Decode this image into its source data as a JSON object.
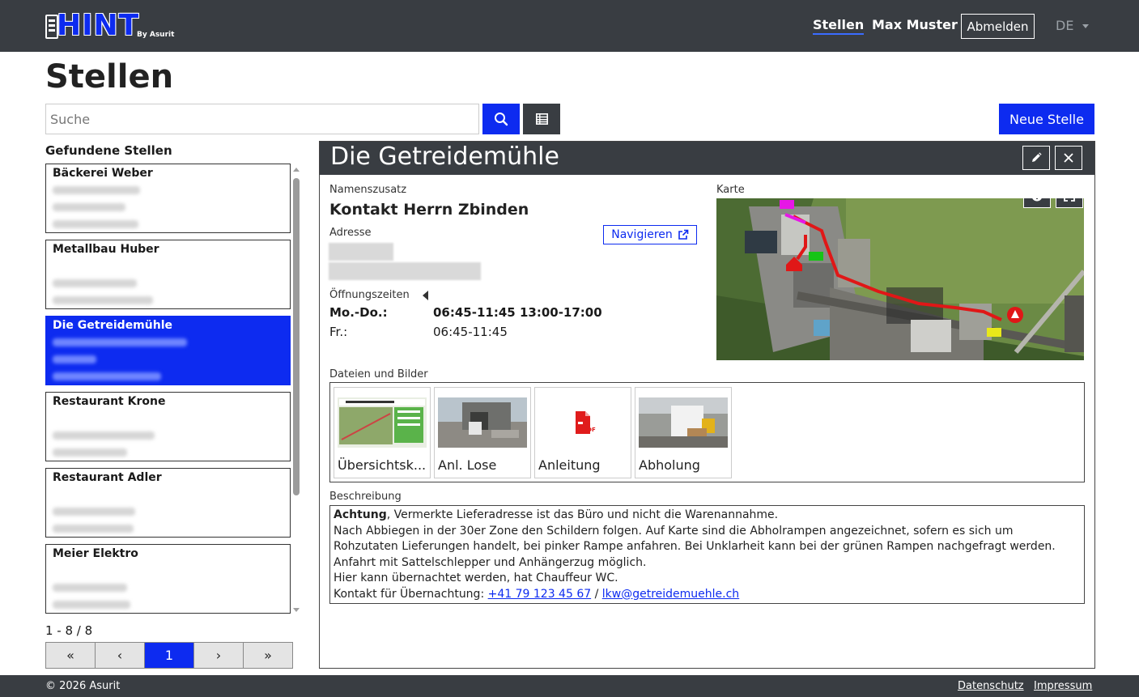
{
  "brand": {
    "logo_text": "HINT",
    "logo_sub": "By Asurit"
  },
  "nav": {
    "stellen": "Stellen",
    "user": "Max Muster",
    "logout": "Abmelden",
    "lang": "DE"
  },
  "page_title": "Stellen",
  "search": {
    "placeholder": "Suche",
    "value": ""
  },
  "buttons": {
    "new": "Neue Stelle"
  },
  "list": {
    "title": "Gefundene Stellen",
    "items": [
      {
        "name": "Bäckerei Weber"
      },
      {
        "name": "Metallbau Huber"
      },
      {
        "name": "Die Getreidemühle"
      },
      {
        "name": "Restaurant Krone"
      },
      {
        "name": "Restaurant Adler"
      },
      {
        "name": "Meier Elektro"
      }
    ],
    "count": "1 - 8 / 8"
  },
  "pager": {
    "first": "«",
    "prev": "‹",
    "current": "1",
    "next": "›",
    "last": "»"
  },
  "detail": {
    "title": "Die Getreidemühle",
    "namenszusatz_label": "Namenszusatz",
    "namenszusatz": "Kontakt Herrn Zbinden",
    "adresse_label": "Adresse",
    "navigate": "Navigieren",
    "hours_label": "Öffnungszeiten",
    "hours": [
      {
        "day": "Mo.-Do.:",
        "time": "06:45-11:45 13:00-17:00"
      },
      {
        "day": "Fr.:",
        "time": "06:45-11:45"
      }
    ],
    "map_label": "Karte",
    "files_label": "Dateien und Bilder",
    "files": [
      {
        "name": "Übersichtsk..."
      },
      {
        "name": "Anl. Lose"
      },
      {
        "name": "Anleitung"
      },
      {
        "name": "Abholung"
      }
    ],
    "desc_label": "Beschreibung",
    "desc": {
      "bold": "Achtung",
      "line1": ", Vermerkte Lieferadresse ist das Büro und nicht die Warenannahme.",
      "line2": "Nach Abbiegen in der 30er Zone den Schildern folgen. Auf Karte sind die Abholrampen angezeichnet, sofern es sich um Rohzutaten Lieferungen handelt, bei pinker Rampe anfahren. Bei Unklarheit kann bei der grünen Rampen nachgefragt werden.",
      "line3": "Anfahrt mit Sattelschlepper und Anhängerzug möglich.",
      "line4": "Hier kann übernachtet werden, hat Chauffeur WC.",
      "line5_prefix": "Kontakt für Übernachtung: ",
      "phone": "+41 79 123 45 67",
      "sep": " / ",
      "email": "lkw@getreidemuehle.ch"
    }
  },
  "footer": {
    "copy": "© 2026 Asurit",
    "privacy": "Datenschutz",
    "imprint": "Impressum"
  }
}
